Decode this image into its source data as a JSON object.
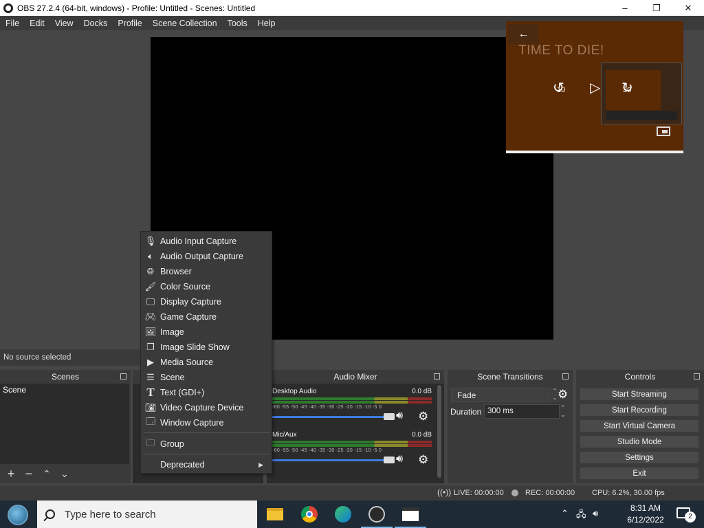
{
  "window": {
    "title": "OBS 27.2.4 (64-bit, windows) - Profile: Untitled - Scenes: Untitled",
    "controls": [
      "–",
      "❐",
      "✕"
    ]
  },
  "menu": [
    "File",
    "Edit",
    "View",
    "Docks",
    "Profile",
    "Scene Collection",
    "Tools",
    "Help"
  ],
  "pip": {
    "title": "TIME TO DIE!",
    "back_icon": "←",
    "rewind_label": "10",
    "forward_label": "30"
  },
  "source_status": "No source selected",
  "docks": {
    "scenes": {
      "title": "Scenes",
      "items": [
        "Scene"
      ]
    },
    "mixer": {
      "title": "Audio Mixer",
      "channels": [
        {
          "name": "Desktop Audio",
          "level": "0.0 dB",
          "volume_fraction": 1.0
        },
        {
          "name": "Mic/Aux",
          "level": "0.0 dB",
          "volume_fraction": 1.0
        }
      ],
      "ticks": "-60  -55  -50  -45  -40  -35  -30  -25  -20  -15  -10  -5   0"
    },
    "transitions": {
      "title": "Scene Transitions",
      "selected": "Fade",
      "duration_label": "Duration",
      "duration_value": "300 ms"
    },
    "controls": {
      "title": "Controls",
      "buttons": [
        "Start Streaming",
        "Start Recording",
        "Start Virtual Camera",
        "Studio Mode",
        "Settings",
        "Exit"
      ]
    }
  },
  "context_menu": {
    "items": [
      {
        "label": "Audio Input Capture",
        "icon": "microphone-icon"
      },
      {
        "label": "Audio Output Capture",
        "icon": "speaker-icon"
      },
      {
        "label": "Browser",
        "icon": "globe-icon"
      },
      {
        "label": "Color Source",
        "icon": "brush-icon"
      },
      {
        "label": "Display Capture",
        "icon": "monitor-icon"
      },
      {
        "label": "Game Capture",
        "icon": "gamepad-icon"
      },
      {
        "label": "Image",
        "icon": "image-icon"
      },
      {
        "label": "Image Slide Show",
        "icon": "slideshow-icon"
      },
      {
        "label": "Media Source",
        "icon": "play-icon"
      },
      {
        "label": "Scene",
        "icon": "list-icon"
      },
      {
        "label": "Text (GDI+)",
        "icon": "text-icon"
      },
      {
        "label": "Video Capture Device",
        "icon": "camera-icon"
      },
      {
        "label": "Window Capture",
        "icon": "window-icon"
      }
    ],
    "group": {
      "label": "Group",
      "icon": "folder-icon"
    },
    "deprecated": {
      "label": "Deprecated"
    }
  },
  "status": {
    "live": "LIVE: 00:00:00",
    "rec": "REC: 00:00:00",
    "cpu": "CPU: 6.2%, 30.00 fps"
  },
  "taskbar": {
    "search_placeholder": "Type here to search",
    "time": "8:31 AM",
    "date": "6/12/2022",
    "notifications": "2"
  }
}
